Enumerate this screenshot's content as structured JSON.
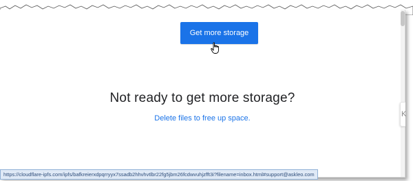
{
  "main": {
    "cta_button_label": "Get more storage",
    "heading": "Not ready to get more storage?",
    "link_text": "Delete files to free up space.",
    "side_tab_label": "K"
  },
  "status_bar": {
    "url": "https://cloudflare-ipfs.com/ipfs/bafkreierxdpqrryyx7ssadb2hhvhvtlbr22fg5jbm26fcdwvuhjzfft3i?filename=inbox.html#support@askleo.com"
  },
  "colors": {
    "accent": "#1a73e8",
    "heading": "#202124",
    "status_bar_bg": "#dfe9f6"
  },
  "icons": {
    "cursor": "hand-pointer-icon"
  }
}
